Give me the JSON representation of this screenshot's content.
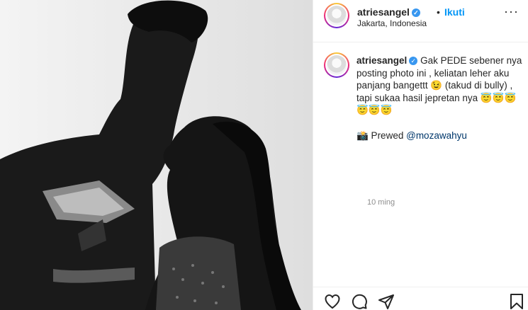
{
  "post": {
    "username": "atriesangel",
    "verified_icon": "verified-badge-icon",
    "separator": "•",
    "follow_label": "Ikuti",
    "location": "Jakarta, Indonesia",
    "more_label": "···"
  },
  "caption": {
    "username": "atriesangel",
    "line1": "Gak PEDE sebener nya posting photo ini , keliatan leher aku panjang bangettt 😉 (takud di bully) , tapi sukaa hasil jepretan nya 😇😇😇😇😇😇",
    "line2_prefix": "📸 Prewed",
    "mention": "@mozawahyu",
    "timestamp": "10 ming"
  },
  "actions": {
    "like": "heart-icon",
    "comment": "comment-icon",
    "share": "share-icon",
    "save": "bookmark-icon"
  },
  "colors": {
    "accent": "#0095f6",
    "verified": "#3897f0",
    "text": "#262626",
    "muted": "#8e8e8e"
  }
}
